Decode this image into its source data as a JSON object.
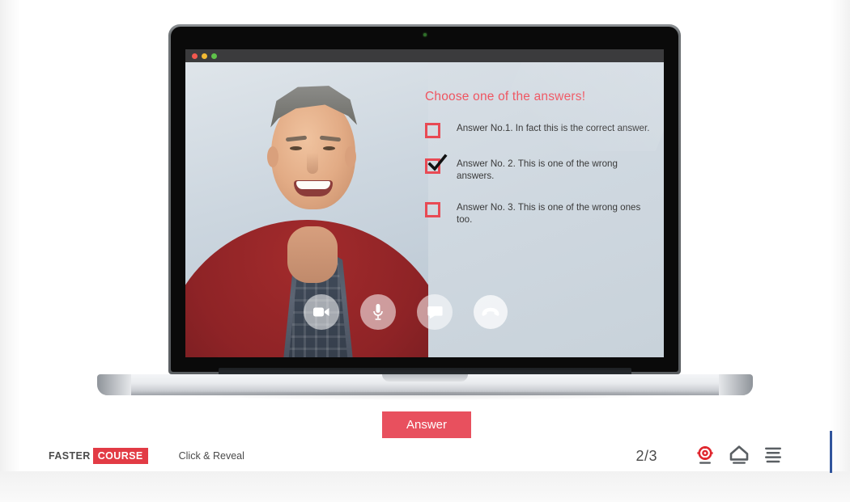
{
  "screen": {
    "window_dots": [
      "close-red",
      "minimize-yellow",
      "maximize-green"
    ],
    "quiz": {
      "title": "Choose one of the answers!",
      "answers": [
        {
          "label": "Answer No.1. In fact this is the correct answer.",
          "checked": false
        },
        {
          "label": "Answer No. 2. This is one of the wrong answers.",
          "checked": true
        },
        {
          "label": "Answer No. 3. This is one of the wrong ones too.",
          "checked": false
        }
      ],
      "accent_color": "#e8505e",
      "title_color": "#ef5561"
    },
    "call_controls": [
      {
        "name": "camera-button",
        "icon": "video-camera-icon"
      },
      {
        "name": "microphone-button",
        "icon": "microphone-icon"
      },
      {
        "name": "chat-button",
        "icon": "speech-bubble-icon"
      },
      {
        "name": "end-call-button",
        "icon": "hang-up-phone-icon"
      }
    ]
  },
  "action": {
    "answer_label": "Answer"
  },
  "footer": {
    "logo_primary": "FASTER",
    "logo_secondary": "COURSE",
    "logo_badge_color": "#e23b45",
    "breadcrumb": "Click & Reveal",
    "page_counter": "2/3",
    "tools": [
      {
        "name": "help-lifebuoy-icon",
        "color": "#e0272e"
      },
      {
        "name": "home-icon",
        "color": "#5a5f63"
      },
      {
        "name": "menu-icon",
        "color": "#5a5f63"
      }
    ]
  },
  "scrollbar": {
    "thumb_color": "#31559c"
  }
}
